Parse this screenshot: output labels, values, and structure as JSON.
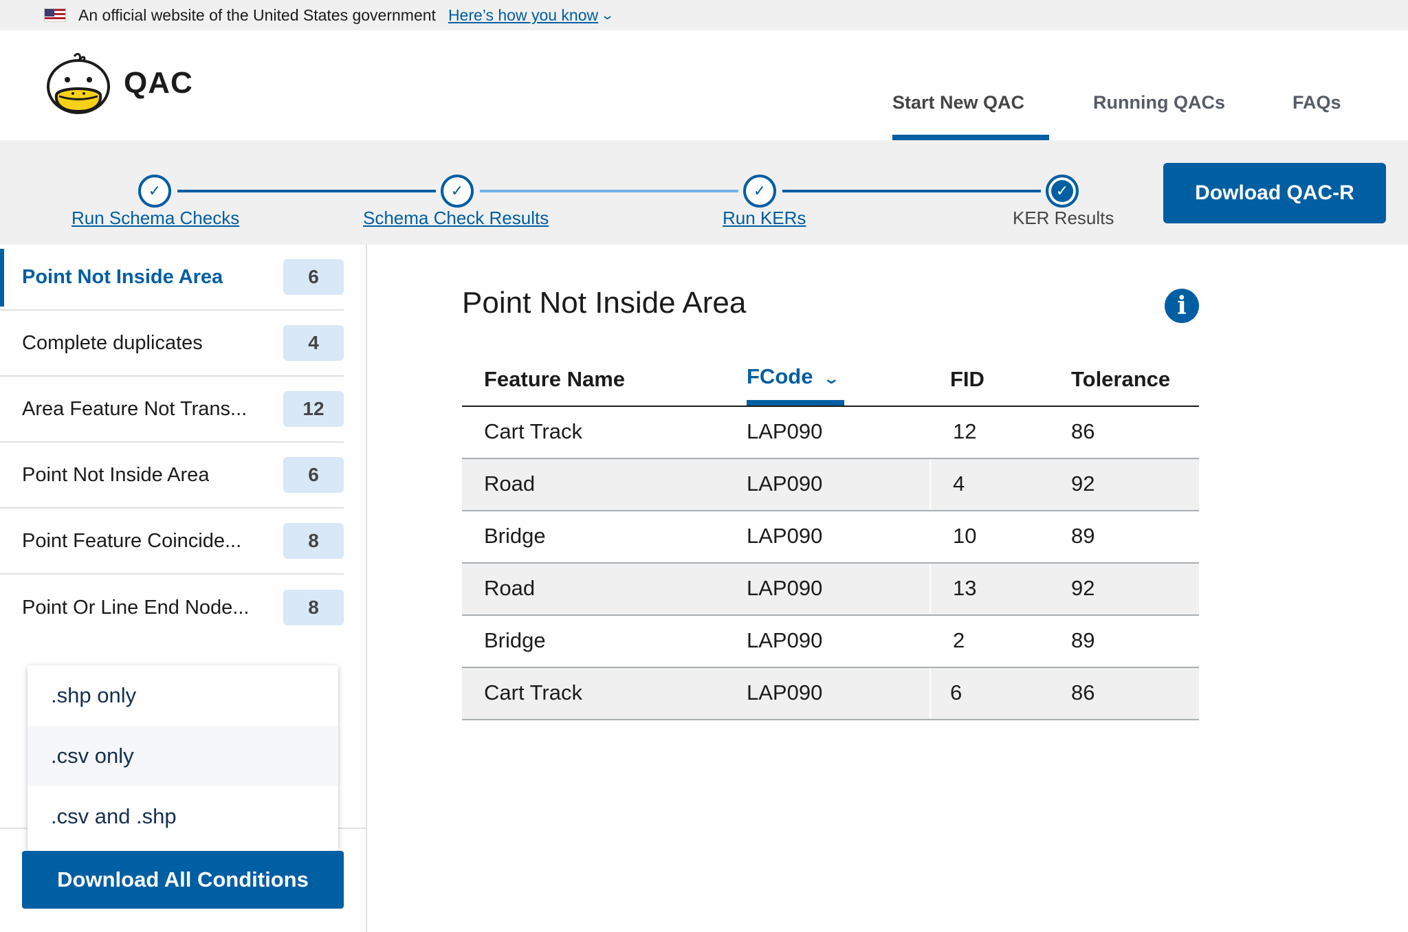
{
  "banner": {
    "text": "An official website of the United States government",
    "link": "Here’s how you know"
  },
  "header": {
    "logo_text": "QAC",
    "nav": [
      {
        "label": "Start New QAC",
        "active": true
      },
      {
        "label": "Running QACs",
        "active": false
      },
      {
        "label": "FAQs",
        "active": false
      }
    ]
  },
  "stepper": {
    "steps": [
      {
        "label": "Run Schema Checks",
        "status": "complete"
      },
      {
        "label": "Schema Check Results",
        "status": "complete"
      },
      {
        "label": "Run KERs",
        "status": "complete"
      },
      {
        "label": "KER Results",
        "status": "current"
      }
    ],
    "download_button": "Dowload QAC-R"
  },
  "sidebar": {
    "items": [
      {
        "label": "Point Not Inside Area",
        "count": "6",
        "active": true
      },
      {
        "label": "Complete duplicates",
        "count": "4",
        "active": false
      },
      {
        "label": "Area Feature Not Trans...",
        "count": "12",
        "active": false
      },
      {
        "label": "Point Not Inside Area",
        "count": "6",
        "active": false
      },
      {
        "label": "Point Feature Coincide...",
        "count": "8",
        "active": false
      },
      {
        "label": "Point Or Line End Node...",
        "count": "8",
        "active": false
      }
    ],
    "dropdown_options": [
      ".shp only",
      ".csv only",
      ".csv and .shp"
    ],
    "download_all": "Download All Conditions"
  },
  "main": {
    "title": "Point Not Inside Area",
    "table": {
      "columns": [
        "Feature Name",
        "FCode",
        "FID",
        "Tolerance"
      ],
      "sorted_column": "FCode",
      "rows": [
        [
          "Cart Track",
          "LAP090",
          "12",
          "86"
        ],
        [
          "Road",
          "LAP090",
          "4",
          "92"
        ],
        [
          "Bridge",
          "LAP090",
          "10",
          "89"
        ],
        [
          "Road",
          "LAP090",
          "13",
          "92"
        ],
        [
          "Bridge",
          "LAP090",
          "2",
          "89"
        ],
        [
          "Cart Track",
          "LAP090",
          "6",
          "86"
        ]
      ]
    }
  },
  "colors": {
    "primary": "#005ea2",
    "badge_bg": "#d9e8f6",
    "stepper_bg": "#f0f0f0",
    "row_alt": "#f0f0f0"
  },
  "icons": {
    "flag": "us-flag-icon",
    "logo": "duck-logo-icon",
    "step_check": "check-circle-icon",
    "info": "info-icon",
    "sort": "chevron-down-icon"
  }
}
